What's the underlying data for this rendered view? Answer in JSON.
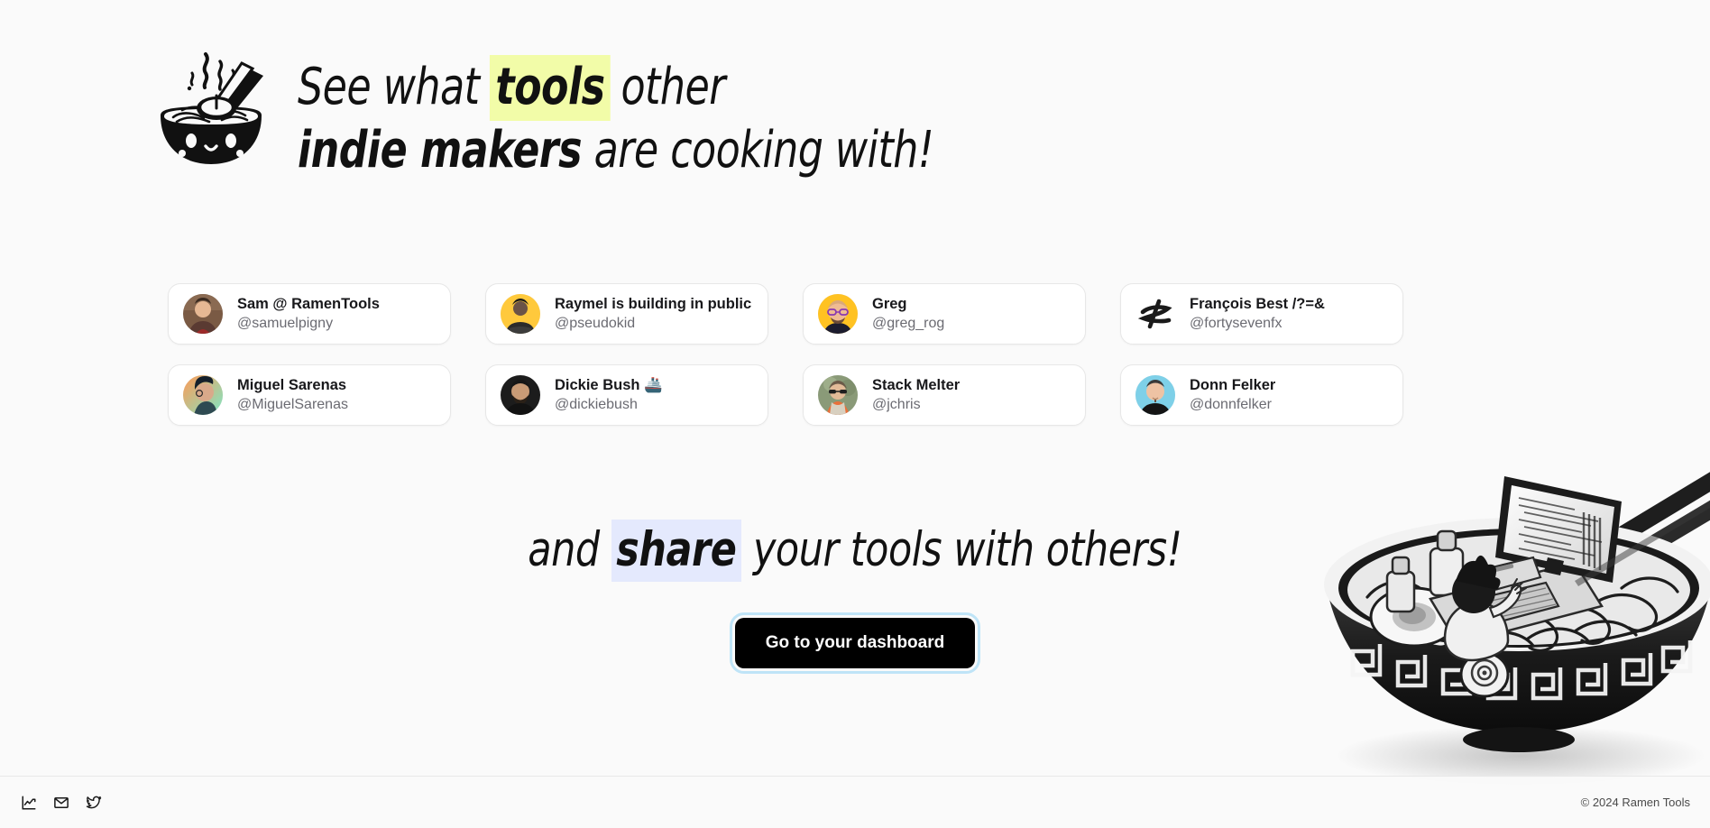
{
  "brand": {
    "logo_icon": "ramen-bowl-logo-icon",
    "name": "Ramen Tools"
  },
  "hero": {
    "line1_pre": "See what ",
    "line1_highlight": "tools",
    "line1_post": " other",
    "line2_highlight": "indie makers",
    "line2_post": " are cooking with!",
    "highlight_color": "#f2fca8"
  },
  "makers": [
    {
      "name": "Sam @ RamenTools",
      "handle": "@samuelpigny",
      "avatar": "photo-avatar-sam"
    },
    {
      "name": "Raymel is building in public",
      "handle": "@pseudokid",
      "avatar": "photo-avatar-raymel"
    },
    {
      "name": "Greg",
      "handle": "@greg_rog",
      "avatar": "photo-avatar-greg"
    },
    {
      "name": "François Best /?=&",
      "handle": "@fortysevenfx",
      "avatar": "logo-avatar-fortysevenfx"
    },
    {
      "name": "Miguel Sarenas",
      "handle": "@MiguelSarenas",
      "avatar": "illustration-avatar-miguel"
    },
    {
      "name": "Dickie Bush 🚢",
      "handle": "@dickiebush",
      "avatar": "photo-avatar-dickie"
    },
    {
      "name": "Stack Melter",
      "handle": "@jchris",
      "avatar": "photo-avatar-jchris"
    },
    {
      "name": "Donn Felker",
      "handle": "@donnfelker",
      "avatar": "photo-avatar-donn"
    }
  ],
  "share": {
    "pre": "and ",
    "highlight": "share",
    "post": " your tools with others!",
    "highlight_color": "#e4e9fd"
  },
  "cta": {
    "label": "Go to your dashboard",
    "background": "#000000",
    "focus_ring": "#bfe4f7"
  },
  "illustration": {
    "name": "ramen-bowl-developer-illustration"
  },
  "footer": {
    "icons": [
      {
        "name": "analytics-chart-icon"
      },
      {
        "name": "envelope-mail-icon"
      },
      {
        "name": "twitter-bird-icon"
      }
    ],
    "copyright": "© 2024 Ramen Tools"
  }
}
